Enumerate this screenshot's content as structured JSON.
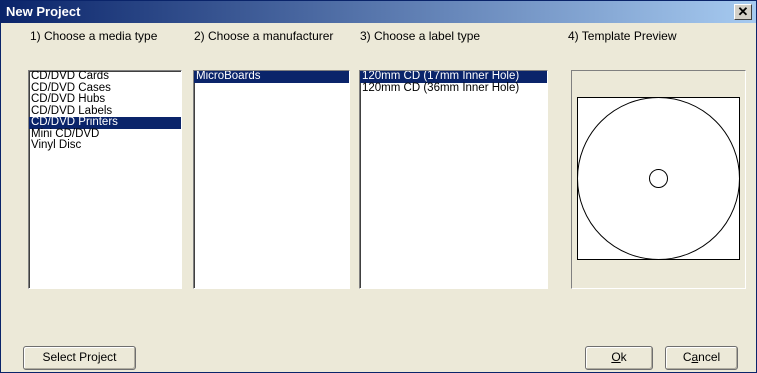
{
  "window": {
    "title": "New Project",
    "close_glyph": "✕"
  },
  "steps": {
    "media": {
      "label": "1) Choose a media type",
      "items": [
        "CD/DVD Cards",
        "CD/DVD Cases",
        "CD/DVD Hubs",
        "CD/DVD Labels",
        "CD/DVD Printers",
        "Mini CD/DVD",
        "Vinyl Disc"
      ],
      "selected": "CD/DVD Printers"
    },
    "manufacturer": {
      "label": "2) Choose a manufacturer",
      "items": [
        "MicroBoards"
      ],
      "selected": "MicroBoards"
    },
    "label_type": {
      "label": "3) Choose a label type",
      "items": [
        "120mm CD  (17mm Inner Hole)",
        "120mm CD  (36mm Inner Hole)"
      ],
      "selected": "120mm CD  (17mm Inner Hole)"
    },
    "preview": {
      "label": "4) Template Preview"
    }
  },
  "buttons": {
    "select_project": "Select Project",
    "ok_mnemonic": "O",
    "ok_rest": "k",
    "cancel_lead": "C",
    "cancel_mnemonic": "a",
    "cancel_rest": "ncel"
  },
  "colors": {
    "selection": "#0a246a",
    "dialog_bg": "#ece9d8"
  }
}
